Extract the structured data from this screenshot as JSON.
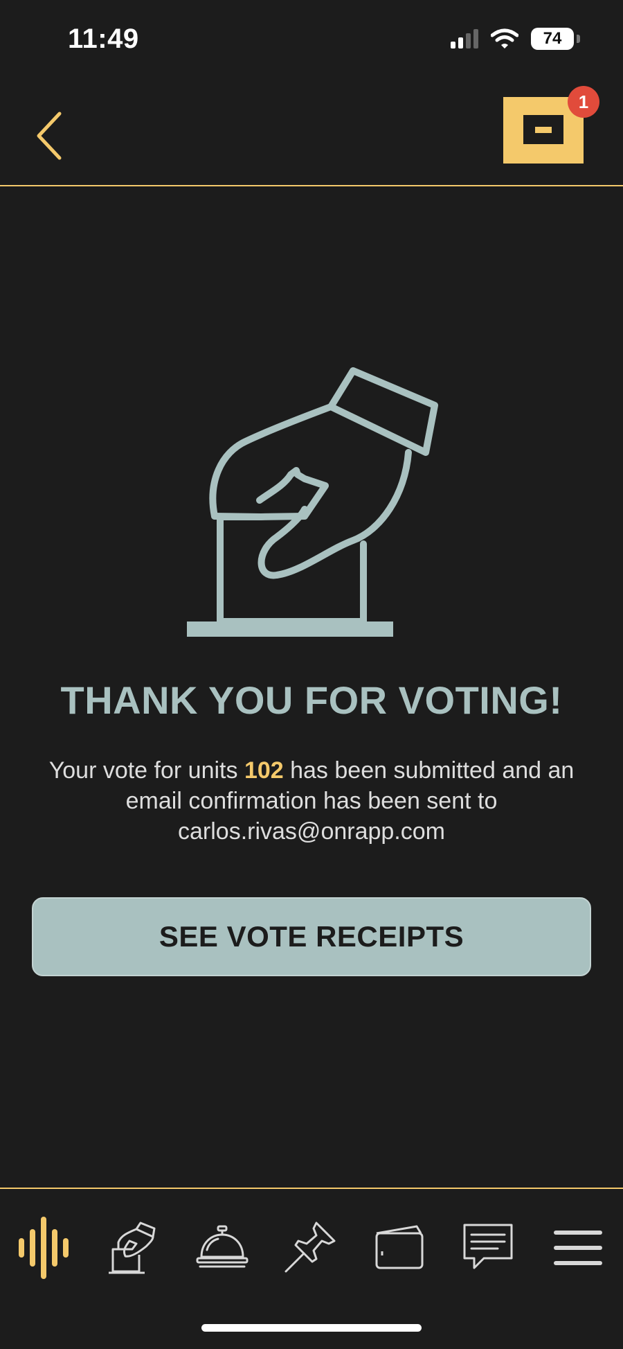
{
  "status_bar": {
    "time": "11:49",
    "battery": "74",
    "icons": [
      "cellular-signal-icon",
      "wifi-icon",
      "battery-icon"
    ]
  },
  "header": {
    "back_icon": "chevron-left-icon",
    "inbox_icon": "inbox-icon",
    "notification_count": "1"
  },
  "main": {
    "illustration_icon": "ballot-box-hand-icon",
    "title": "THANK YOU FOR VOTING!",
    "message_prefix": "Your vote for units ",
    "units": "102",
    "message_suffix": " has been submitted and an email confirmation has been sent to carlos.rivas@onrapp.com",
    "receipts_button": "SEE VOTE RECEIPTS"
  },
  "bottom_nav": {
    "items": [
      {
        "icon": "audio-waves-icon",
        "active": true
      },
      {
        "icon": "ballot-vote-icon",
        "active": false
      },
      {
        "icon": "service-bell-icon",
        "active": false
      },
      {
        "icon": "pushpin-icon",
        "active": false
      },
      {
        "icon": "wallet-icon",
        "active": false
      },
      {
        "icon": "chat-message-icon",
        "active": false
      },
      {
        "icon": "menu-icon",
        "active": false
      }
    ]
  },
  "colors": {
    "background": "#1c1c1c",
    "accent": "#f4c96b",
    "teal": "#a9c1c0",
    "badge": "#e14b3b"
  }
}
